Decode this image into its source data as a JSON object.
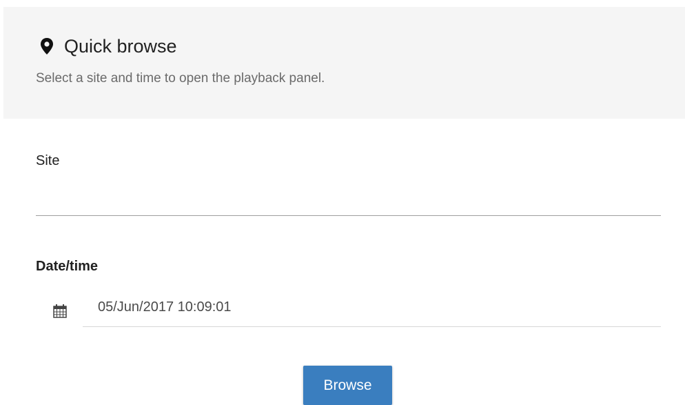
{
  "header": {
    "icon": "map-marker-icon",
    "title": "Quick browse",
    "subtitle": "Select a site and time to open the playback panel."
  },
  "site": {
    "label": "Site",
    "value": ""
  },
  "datetime": {
    "label": "Date/time",
    "icon": "calendar-icon",
    "value": "05/Jun/2017 10:09:01"
  },
  "actions": {
    "browse_label": "Browse"
  },
  "colors": {
    "header_bg": "#f5f5f5",
    "button_bg": "#3a7ebf",
    "button_text": "#ffffff"
  }
}
